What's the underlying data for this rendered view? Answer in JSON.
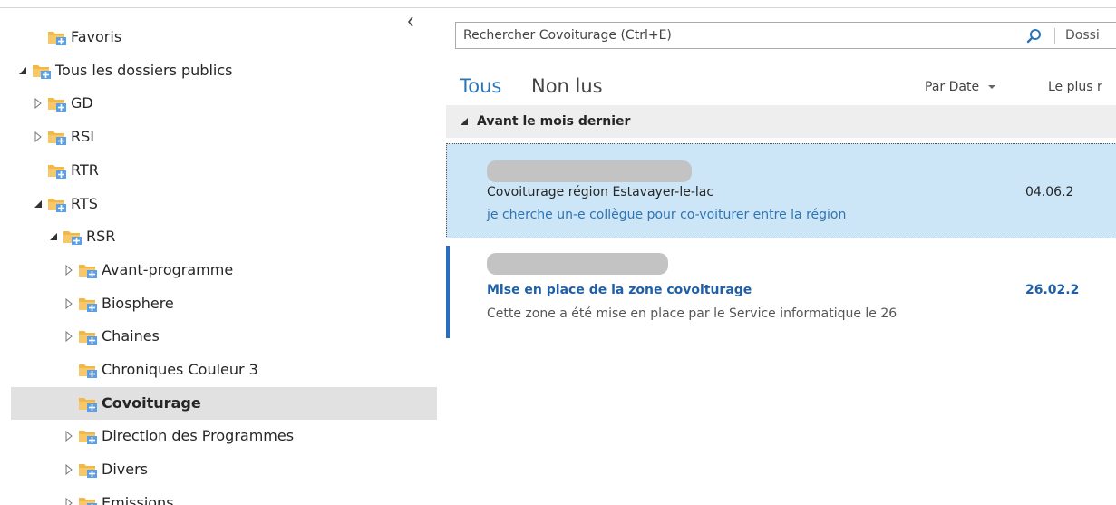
{
  "folder_pane": {
    "items": [
      {
        "label": "Favoris",
        "toggle": "none",
        "icon": "public-folder-icon"
      },
      {
        "label": "Tous les dossiers publics",
        "toggle": "expanded",
        "icon": "public-folder-icon"
      },
      {
        "label": "GD",
        "toggle": "collapsed",
        "icon": "public-folder-icon"
      },
      {
        "label": "RSI",
        "toggle": "collapsed",
        "icon": "public-folder-icon"
      },
      {
        "label": "RTR",
        "toggle": "none",
        "icon": "public-folder-icon"
      },
      {
        "label": "RTS",
        "toggle": "expanded",
        "icon": "public-folder-icon"
      },
      {
        "label": "RSR",
        "toggle": "expanded",
        "icon": "public-folder-icon"
      },
      {
        "label": "Avant-programme",
        "toggle": "collapsed",
        "icon": "public-folder-icon"
      },
      {
        "label": "Biosphere",
        "toggle": "collapsed",
        "icon": "public-folder-icon"
      },
      {
        "label": "Chaines",
        "toggle": "collapsed",
        "icon": "public-folder-icon"
      },
      {
        "label": "Chroniques Couleur 3",
        "toggle": "none",
        "icon": "public-folder-icon"
      },
      {
        "label": "Covoiturage",
        "toggle": "none",
        "icon": "public-folder-icon",
        "selected": true
      },
      {
        "label": "Direction des Programmes",
        "toggle": "collapsed",
        "icon": "public-folder-icon"
      },
      {
        "label": "Divers",
        "toggle": "collapsed",
        "icon": "public-folder-icon"
      },
      {
        "label": "Emissions",
        "toggle": "collapsed",
        "icon": "public-folder-icon"
      }
    ]
  },
  "search": {
    "placeholder": "Rechercher Covoiturage (Ctrl+E)",
    "scope": "Dossi"
  },
  "tabs": {
    "all": "Tous",
    "unread": "Non lus"
  },
  "sort": {
    "by": "Par Date",
    "order": "Le plus r"
  },
  "group": {
    "label": "Avant le mois dernier"
  },
  "messages": [
    {
      "subject": "Covoiturage région Estavayer-le-lac",
      "date": "04.06.2",
      "preview": "je cherche un-e collègue pour co-voiturer entre la région",
      "state": "selected"
    },
    {
      "subject": "Mise en place de la zone covoiturage",
      "date": "26.02.2",
      "preview": "Cette zone a été mise en place par le Service informatique le 26",
      "state": "unread"
    }
  ],
  "colors": {
    "accent": "#2e74b5",
    "selection": "#cde6f7",
    "unread_bar": "#2a6dbf",
    "folder": "#f2b845"
  }
}
